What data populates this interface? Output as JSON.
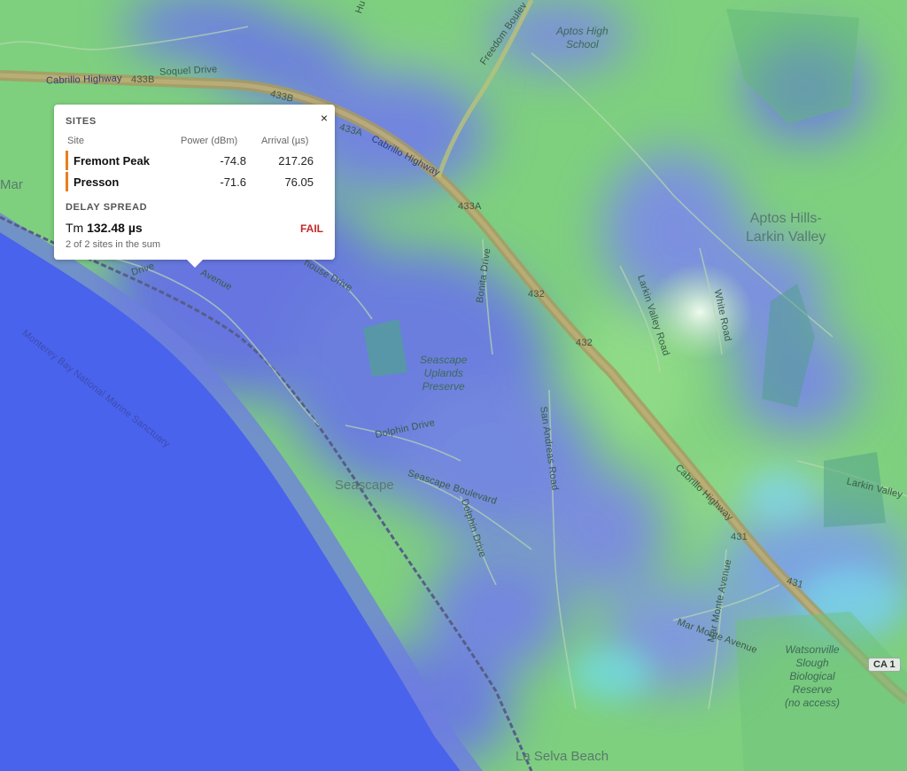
{
  "colors": {
    "land": "#7ed07e",
    "ocean": "#4a63ec",
    "coverage": "#5f6cf0",
    "highway": "#a89a63",
    "site_accent": "#e87e1d",
    "fail": "#c62828"
  },
  "map": {
    "labels": {
      "soquel_drive": "Soquel Drive",
      "cabrillo_hwy_nw": "Cabrillo Highway",
      "cabrillo_hwy_mid": "Cabrillo Highway",
      "cabrillo_hwy_se": "Cabrillo Highway",
      "freedom_blvd": "Freedom Boulev",
      "aptos_high_school": "Aptos High\nSchool",
      "aptos_hills": "Aptos Hills-\nLarkin Valley",
      "larkin_valley_road": "Larkin Valley Road",
      "larkin_valley_e": "Larkin Valley",
      "white_road": "White Road",
      "bonita_drive": "Bonita Drive",
      "seascape_uplands": "Seascape\nUplands\nPreserve",
      "dolphin_drive": "Dolphin Drive",
      "dolphin_drive_2": "Dolphin Drive",
      "seascape": "Seascape",
      "seascape_blvd": "Seascape Boulevard",
      "san_andreas_road": "San Andreas Road",
      "mar_monte": "Mar Monte Avenue",
      "watsonville_slough": "Watsonville\nSlough\nBiological\nReserve\n(no access)",
      "la_selva_beach": "La Selva Beach",
      "monterey_bay": "Monterey Bay National Marine Sanctuary",
      "lighthouse_drive": "house Drive",
      "avenue_partial": "Avenue",
      "drive_partial": "Drive",
      "mar_partial": "Mar",
      "hu_partial": "Hu"
    },
    "shields": {
      "r433b_a": "433B",
      "r433b_b": "433B",
      "r433a_a": "433A",
      "r433a_b": "433A",
      "r432_a": "432",
      "r432_b": "432",
      "r431_a": "431",
      "r431_b": "431",
      "ca1": "CA 1"
    }
  },
  "popup": {
    "sites_title": "SITES",
    "columns": {
      "site": "Site",
      "power": "Power (dBm)",
      "arrival": "Arrival (µs)"
    },
    "sites": [
      {
        "name": "Fremont Peak",
        "power": "-74.8",
        "arrival": "217.26"
      },
      {
        "name": "Presson",
        "power": "-71.6",
        "arrival": "76.05"
      }
    ],
    "delay_title": "DELAY SPREAD",
    "tm_label": "Tm",
    "tm_value": "132.48 µs",
    "status": "FAIL",
    "note": "2 of 2 sites in the sum",
    "close_symbol": "×"
  }
}
